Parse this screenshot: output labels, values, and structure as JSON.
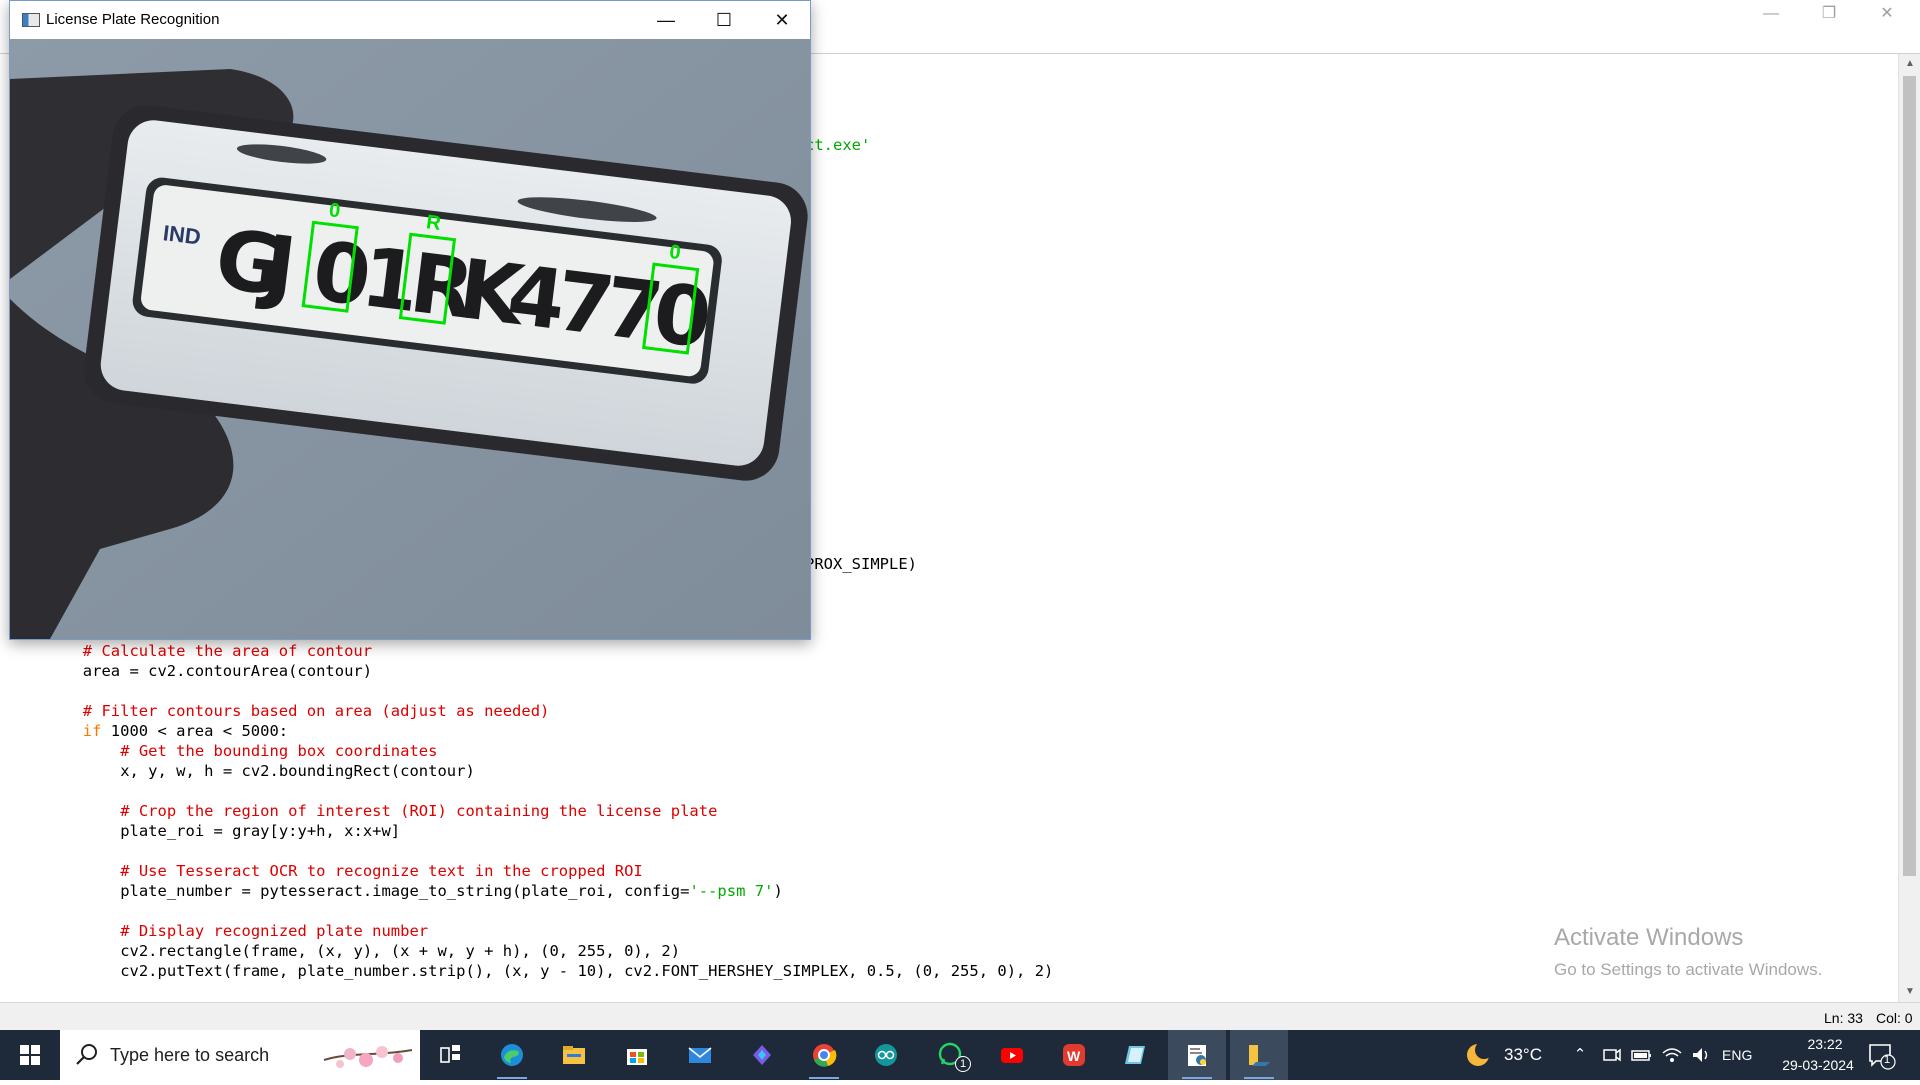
{
  "editor": {
    "window_controls": {
      "minimize": "—",
      "maximize": "❐",
      "close": "✕"
    },
    "visible_fragments": {
      "tesseract_path_tail": "ct.exe'",
      "find_contours_tail": "PROX_SIMPLE)"
    },
    "code_lines": [
      {
        "indent": 8,
        "parts": [
          {
            "t": "# Calculate the area of contour",
            "c": "cm"
          }
        ]
      },
      {
        "indent": 8,
        "parts": [
          {
            "t": "area = cv2.contourArea(contour)",
            "c": ""
          }
        ]
      },
      {
        "indent": 0,
        "parts": []
      },
      {
        "indent": 8,
        "parts": [
          {
            "t": "# Filter contours based on area (adjust as needed)",
            "c": "cm"
          }
        ]
      },
      {
        "indent": 8,
        "parts": [
          {
            "t": "if",
            "c": "kw"
          },
          {
            "t": " 1000 < area < 5000:",
            "c": ""
          }
        ]
      },
      {
        "indent": 12,
        "parts": [
          {
            "t": "# Get the bounding box coordinates",
            "c": "cm"
          }
        ]
      },
      {
        "indent": 12,
        "parts": [
          {
            "t": "x, y, w, h = cv2.boundingRect(contour)",
            "c": ""
          }
        ]
      },
      {
        "indent": 0,
        "parts": []
      },
      {
        "indent": 12,
        "parts": [
          {
            "t": "# Crop the region of interest (ROI) containing the license plate",
            "c": "cm"
          }
        ]
      },
      {
        "indent": 12,
        "parts": [
          {
            "t": "plate_roi = gray[y:y+h, x:x+w]",
            "c": ""
          }
        ]
      },
      {
        "indent": 0,
        "parts": []
      },
      {
        "indent": 12,
        "parts": [
          {
            "t": "# Use Tesseract OCR to recognize text in the cropped ROI",
            "c": "cm"
          }
        ]
      },
      {
        "indent": 12,
        "parts": [
          {
            "t": "plate_number = pytesseract.image_to_string(plate_roi, config=",
            "c": ""
          },
          {
            "t": "'--psm 7'",
            "c": "st"
          },
          {
            "t": ")",
            "c": ""
          }
        ]
      },
      {
        "indent": 0,
        "parts": []
      },
      {
        "indent": 12,
        "parts": [
          {
            "t": "# Display recognized plate number",
            "c": "cm"
          }
        ]
      },
      {
        "indent": 12,
        "parts": [
          {
            "t": "cv2.rectangle(frame, (x, y), (x + w, y + h), (0, 255, 0), 2)",
            "c": ""
          }
        ]
      },
      {
        "indent": 12,
        "parts": [
          {
            "t": "cv2.putText(frame, plate_number.strip(), (x, y - 10), cv2.FONT_HERSHEY_SIMPLEX, 0.5, (0, 255, 0), 2)",
            "c": ""
          }
        ]
      }
    ],
    "status": {
      "line": "Ln: 33",
      "col": "Col: 0"
    }
  },
  "activation": {
    "title": "Activate Windows",
    "subtitle": "Go to Settings to activate Windows."
  },
  "lpr_window": {
    "title": "License Plate Recognition",
    "controls": {
      "minimize": "—",
      "maximize": "☐",
      "close": "✕"
    },
    "plate": {
      "country": "IND",
      "characters": [
        "G",
        "J",
        "0",
        "1",
        "R",
        "K",
        "4",
        "7",
        "7",
        "0"
      ],
      "detections": [
        {
          "char_index": 2,
          "label": "0"
        },
        {
          "char_index": 4,
          "label": "R"
        },
        {
          "char_index": 9,
          "label": "0"
        }
      ],
      "box_color": "#00e000"
    }
  },
  "taskbar": {
    "search_placeholder": "Type here to search",
    "apps": [
      {
        "name": "task-view",
        "badge": ""
      },
      {
        "name": "edge",
        "badge": ""
      },
      {
        "name": "file-explorer",
        "badge": ""
      },
      {
        "name": "microsoft-store",
        "badge": ""
      },
      {
        "name": "mail",
        "badge": ""
      },
      {
        "name": "copilot",
        "badge": ""
      },
      {
        "name": "chrome",
        "badge": ""
      },
      {
        "name": "arduino",
        "badge": ""
      },
      {
        "name": "whatsapp",
        "badge": "1"
      },
      {
        "name": "youtube",
        "badge": ""
      },
      {
        "name": "wps-office",
        "badge": ""
      },
      {
        "name": "notepad",
        "badge": ""
      },
      {
        "name": "python-idle",
        "badge": ""
      },
      {
        "name": "python-window",
        "badge": ""
      }
    ],
    "weather": {
      "temp": "33°C"
    },
    "language": "ENG",
    "time": "23:22",
    "date": "29-03-2024",
    "notification_badge": "1"
  }
}
